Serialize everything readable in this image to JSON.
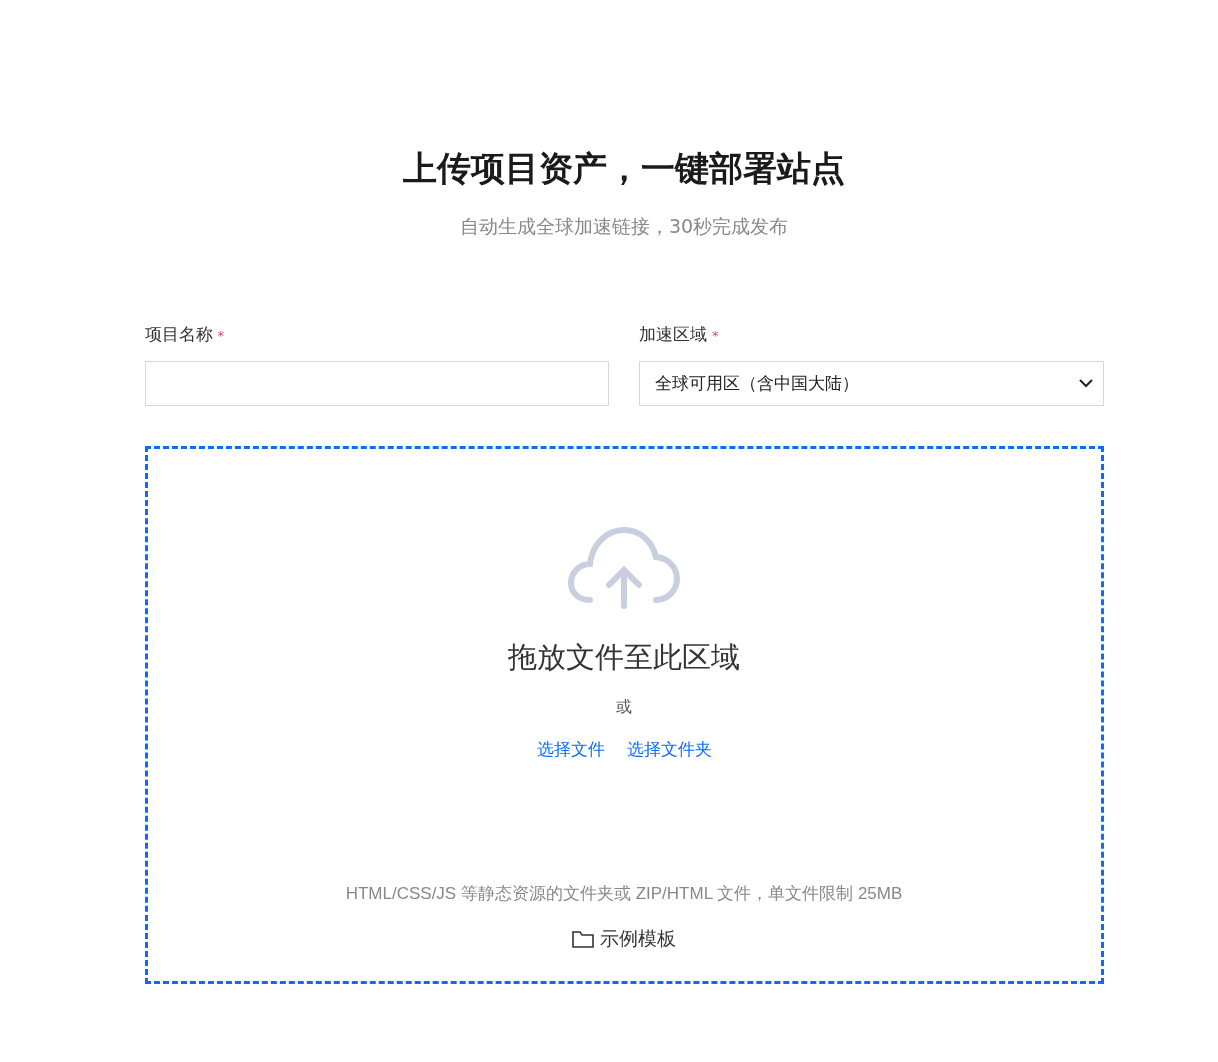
{
  "header": {
    "title": "上传项目资产，一键部署站点",
    "subtitle": "自动生成全球加速链接，30秒完成发布"
  },
  "fields": [
    {
      "kind": "text",
      "label": "项目名称",
      "required_mark": "*"
    },
    {
      "kind": "select",
      "label": "加速区域",
      "required_mark": "*",
      "value": "全球可用区（含中国大陆）"
    }
  ],
  "dropzone": {
    "title": "拖放文件至此区域",
    "or": "或",
    "links": [
      "选择文件",
      "选择文件夹"
    ],
    "hint": "HTML/CSS/JS 等静态资源的文件夹或 ZIP/HTML 文件，单文件限制 25MB",
    "template": "示例模板"
  }
}
